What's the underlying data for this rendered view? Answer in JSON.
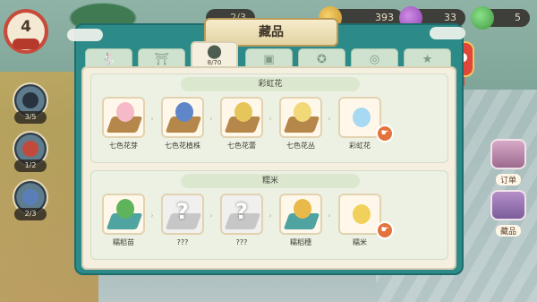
{
  "hud": {
    "level": "4",
    "level_tag": "",
    "resource_hidden": "2/3",
    "gold": "393",
    "gem": "33",
    "leaf": "5",
    "slots": [
      {
        "count": "3/5",
        "icon": "bird-icon"
      },
      {
        "count": "1/2",
        "icon": "warrior-icon"
      },
      {
        "count": "2/3",
        "icon": "fish-icon"
      }
    ],
    "right_buttons": [
      {
        "label": "订单",
        "icon": "order-icon"
      },
      {
        "label": "藏品",
        "icon": "collection-icon"
      }
    ]
  },
  "panel": {
    "title": "藏品",
    "tabs": [
      {
        "icon": "rabbit-icon",
        "glyph": "🐇",
        "sub": ""
      },
      {
        "icon": "house-icon",
        "glyph": "⛩",
        "sub": ""
      },
      {
        "icon": "seed-bag-icon",
        "glyph": "⬤",
        "sub": "8/70",
        "active": true
      },
      {
        "icon": "cloth-icon",
        "glyph": "▣",
        "sub": ""
      },
      {
        "icon": "candy-icon",
        "glyph": "✪",
        "sub": ""
      },
      {
        "icon": "coin-icon",
        "glyph": "◎",
        "sub": ""
      },
      {
        "icon": "star-icon",
        "glyph": "★",
        "sub": ""
      }
    ],
    "sections": [
      {
        "title": "彩虹花",
        "items": [
          {
            "name": "七色花芽",
            "color": "#f6b9c8",
            "unknown": false
          },
          {
            "name": "七色花植株",
            "color": "#5f86c9",
            "unknown": false
          },
          {
            "name": "七色花蕾",
            "color": "#e6c65a",
            "unknown": false
          },
          {
            "name": "七色花丛",
            "color": "#f1d97a",
            "unknown": false
          },
          {
            "name": "彩虹花",
            "color": "#a7d9f2",
            "unknown": false
          }
        ]
      },
      {
        "title": "糯米",
        "items": [
          {
            "name": "糯稻苗",
            "color": "#5fb35a",
            "unknown": false
          },
          {
            "name": "???",
            "color": "#bdbdbd",
            "unknown": true
          },
          {
            "name": "???",
            "color": "#bdbdbd",
            "unknown": true
          },
          {
            "name": "糯稻穗",
            "color": "#e9b94a",
            "unknown": false
          },
          {
            "name": "糯米",
            "color": "#f1d15c",
            "unknown": false
          }
        ]
      }
    ]
  }
}
